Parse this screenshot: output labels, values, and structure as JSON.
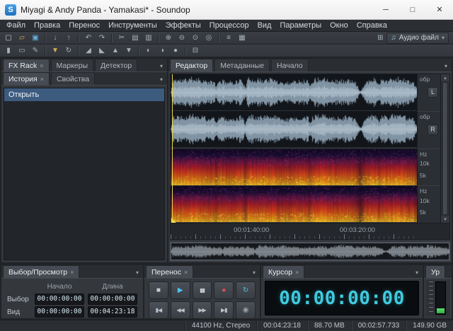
{
  "window": {
    "title": "Miyagi & Andy Panda - Yamakasi* - Soundop",
    "icon_letter": "S",
    "controls": {
      "minimize": "─",
      "maximize": "□",
      "close": "✕"
    }
  },
  "glyphs": {
    "tab_close": "×",
    "caret": "▾",
    "scroll_up": "▴",
    "scroll_down": "▾"
  },
  "menu": {
    "items": [
      {
        "label": "Файл"
      },
      {
        "label": "Правка"
      },
      {
        "label": "Перенос"
      },
      {
        "label": "Инструменты"
      },
      {
        "label": "Эффекты"
      },
      {
        "label": "Процессор"
      },
      {
        "label": "Вид"
      },
      {
        "label": "Параметры"
      },
      {
        "label": "Окно"
      },
      {
        "label": "Справка"
      }
    ]
  },
  "toolbar_main": {
    "items": [
      {
        "name": "new-file-icon",
        "glyph": "▢",
        "color": "#c9ced3"
      },
      {
        "name": "open-file-icon",
        "glyph": "▱",
        "color": "#d9b05a"
      },
      {
        "name": "save-icon",
        "glyph": "▣",
        "color": "#6aaede"
      },
      {
        "sep": true
      },
      {
        "name": "import-icon",
        "glyph": "↓"
      },
      {
        "name": "export-icon",
        "glyph": "↑"
      },
      {
        "sep": true
      },
      {
        "name": "undo-icon",
        "glyph": "↶"
      },
      {
        "name": "redo-icon",
        "glyph": "↷"
      },
      {
        "sep": true
      },
      {
        "name": "cut-icon",
        "glyph": "✂"
      },
      {
        "name": "copy-icon",
        "glyph": "▤"
      },
      {
        "name": "paste-icon",
        "glyph": "▥"
      },
      {
        "sep": true
      },
      {
        "name": "zoom-in-icon",
        "glyph": "⊕"
      },
      {
        "name": "zoom-out-icon",
        "glyph": "⊖"
      },
      {
        "name": "zoom-selection-icon",
        "glyph": "⊙"
      },
      {
        "name": "zoom-full-icon",
        "glyph": "◎"
      },
      {
        "sep": true
      },
      {
        "name": "mixer-icon",
        "glyph": "≡"
      },
      {
        "name": "spectral-view-icon",
        "glyph": "▦"
      }
    ],
    "right_items": [
      {
        "name": "workspace-layout-icon",
        "glyph": "⊞"
      }
    ],
    "audio_file_dropdown": {
      "label": "Аудио файл",
      "caret": "▾",
      "icon_glyph": "♫"
    }
  },
  "toolbar_tools": {
    "items": [
      {
        "name": "time-selection-tool-icon",
        "glyph": "▮"
      },
      {
        "name": "range-selection-tool-icon",
        "glyph": "▭"
      },
      {
        "name": "edit-tool-icon",
        "glyph": "✎"
      },
      {
        "sep": true
      },
      {
        "name": "add-marker-icon",
        "glyph": "▼",
        "color": "#d9b05a"
      },
      {
        "name": "loop-playback-icon",
        "glyph": "↻"
      },
      {
        "sep": true
      },
      {
        "name": "fade-in-icon",
        "glyph": "◢"
      },
      {
        "name": "fade-out-icon",
        "glyph": "◣"
      },
      {
        "name": "gain-up-icon",
        "glyph": "▲"
      },
      {
        "name": "gain-down-icon",
        "glyph": "▼"
      },
      {
        "sep": true
      },
      {
        "name": "left-channel-icon",
        "glyph": "◐"
      },
      {
        "name": "right-channel-icon",
        "glyph": "◑"
      },
      {
        "name": "both-channels-icon",
        "glyph": "●"
      },
      {
        "sep": true
      },
      {
        "name": "snap-icon",
        "glyph": "⊟"
      }
    ]
  },
  "left_panel": {
    "tabs": [
      {
        "label": "FX Rack",
        "closable": true
      },
      {
        "label": "Маркеры"
      },
      {
        "label": "Детектор"
      }
    ],
    "subtabs": [
      {
        "label": "История",
        "closable": true
      },
      {
        "label": "Свойства"
      }
    ],
    "history_items": [
      {
        "label": "Открыть",
        "selected": true
      }
    ]
  },
  "editor": {
    "tabs": [
      {
        "label": "Редактор"
      },
      {
        "label": "Метаданные"
      },
      {
        "label": "Начало"
      }
    ],
    "wave_ruler": {
      "unit": "обр",
      "channels": [
        "L",
        "R"
      ]
    },
    "spec_ruler": {
      "unit": "Hz",
      "ticks": [
        "10k",
        "5k"
      ]
    },
    "timeline": {
      "labels": [
        {
          "text": "00:01:40:00",
          "pos": "29%"
        },
        {
          "text": "00:03:20:00",
          "pos": "67%"
        }
      ]
    }
  },
  "selection_panel": {
    "tab": "Выбор/Просмотр",
    "columns": [
      "Начало",
      "Длина"
    ],
    "rows": [
      {
        "label": "Выбор",
        "start": "00:00:00:00",
        "length": "00:00:00:00"
      },
      {
        "label": "Вид",
        "start": "00:00:00:00",
        "length": "00:04:23:18"
      }
    ]
  },
  "transport_panel": {
    "tab": "Перенос",
    "row1": [
      {
        "name": "stop-button",
        "glyph": "■",
        "color": "#c7ccd1"
      },
      {
        "name": "play-button",
        "glyph": "▶",
        "color": "#4fc3e8"
      },
      {
        "name": "pause-button",
        "glyph": "▮▮",
        "color": "#c7ccd1"
      },
      {
        "name": "record-button",
        "glyph": "●",
        "color": "#e05050"
      },
      {
        "name": "loop-button",
        "glyph": "↻",
        "color": "#45cede"
      }
    ],
    "row2": [
      {
        "name": "go-to-start-button",
        "glyph": "▮◀",
        "color": "#b9c0c7"
      },
      {
        "name": "rewind-button",
        "glyph": "◀◀",
        "color": "#b9c0c7"
      },
      {
        "name": "fast-forward-button",
        "glyph": "▶▶",
        "color": "#b9c0c7"
      },
      {
        "name": "go-to-end-button",
        "glyph": "▶▮",
        "color": "#b9c0c7"
      },
      {
        "name": "record-options-button",
        "glyph": "◉",
        "color": "#9aa1a8"
      }
    ]
  },
  "cursor_panel": {
    "tab": "Курсор",
    "time": "00:00:00:00"
  },
  "levels_panel": {
    "tab": "Ур"
  },
  "status_bar": {
    "fields": [
      "44100 Hz, Стерео",
      "00:04:23:18",
      "88.70 MB",
      "00:02:57.733",
      "149.90 GB"
    ]
  },
  "colors": {
    "accent_cyan": "#3ecadf",
    "playhead_yellow": "#ecd84f",
    "record_red": "#e05050",
    "selection_blue": "#3d5b7e",
    "meter_green": "#43d65c"
  }
}
